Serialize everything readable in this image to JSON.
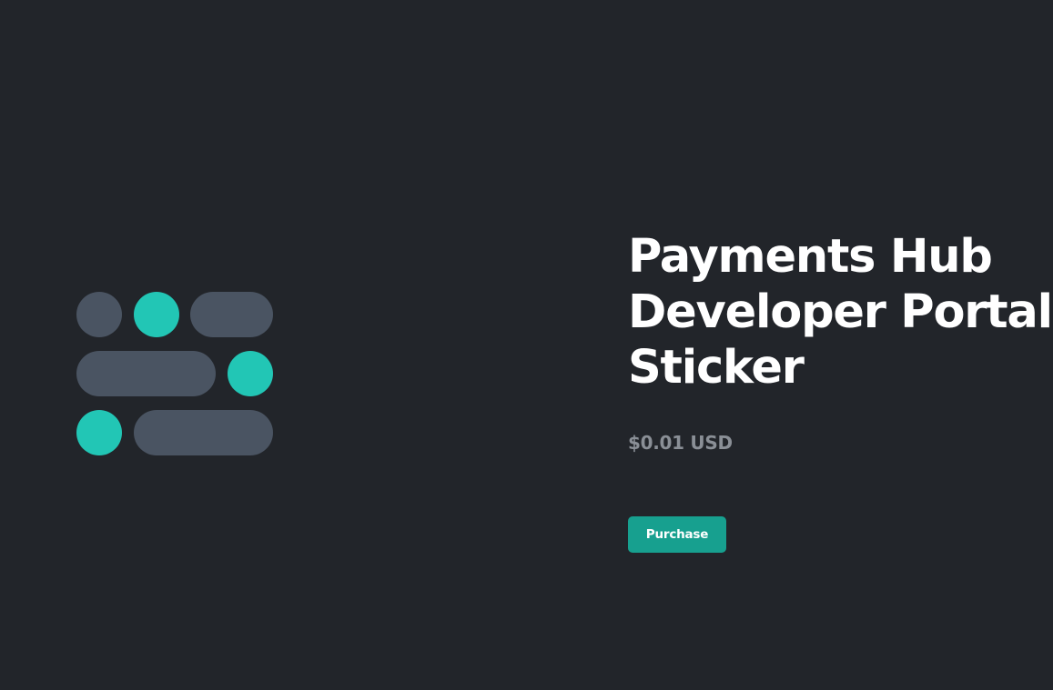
{
  "product": {
    "title_lines": [
      "Payments Hub",
      "Developer Portal",
      "Sticker"
    ],
    "price": "$0.01 USD",
    "purchase_label": "Purchase"
  },
  "colors": {
    "background": "#22252a",
    "logo_gray": "#4a5462",
    "logo_teal": "#22c6b5",
    "price_text": "#8a8f96",
    "button_bg": "#17a08f",
    "title_text": "#ffffff"
  }
}
